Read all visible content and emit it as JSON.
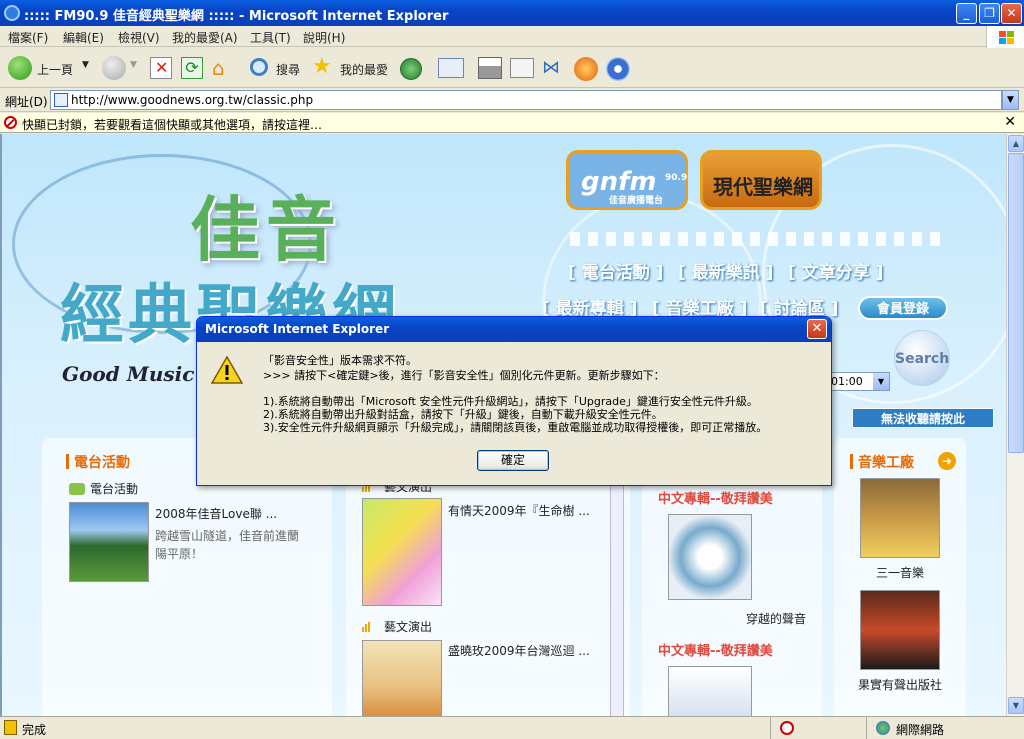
{
  "window": {
    "title": "::::: FM90.9 佳音經典聖樂網 ::::: - Microsoft Internet Explorer"
  },
  "menu": [
    "檔案(F)",
    "編輯(E)",
    "檢視(V)",
    "我的最愛(A)",
    "工具(T)",
    "說明(H)"
  ],
  "toolbar": {
    "back": "上一頁",
    "search": "搜尋",
    "favorites": "我的最愛"
  },
  "address": {
    "label": "網址(D)",
    "url": "http://www.goodnews.org.tw/classic.php"
  },
  "infobar": {
    "text": "快顯已封鎖，若要觀看這個快顯或其他選項，請按這裡…"
  },
  "page": {
    "title_line1": "佳音",
    "title_line2": "經典聖樂網",
    "tagline": "Good Music",
    "logo1": "gnfm",
    "logo1_sub": "佳音廣播電台",
    "logo1_num": "90.9",
    "logo2": "現代聖樂網",
    "nav_row1": [
      "[ 電台活動 ]",
      "[ 最新樂訊 ]",
      "[ 文章分享 ]"
    ],
    "nav_row2": [
      "[ 最新專輯 ]",
      "[ 音樂工廠 ]",
      "[ 討論區 ]"
    ],
    "member_button": "會員登錄",
    "search_button": "Search",
    "time_select": "01:00",
    "cant_view": "無法收聽請按此",
    "station": {
      "heading": "電台活動",
      "sub": "電台活動",
      "item_title": "2008年佳音Love聯 ...",
      "item_desc_1": "跨越雪山隧道，佳音前進蘭",
      "item_desc_2": "陽平原！"
    },
    "arts": {
      "sub1": "藝文演出",
      "item1": "有情天2009年『生命樹 ...",
      "sub2": "藝文演出",
      "item2": "盛曉玫2009年台灣巡迴 ..."
    },
    "albums": {
      "head1": "中文專輯--敬拜讚美",
      "item1": "穿越的聲音",
      "head2": "中文專輯--敬拜讚美"
    },
    "factory": {
      "heading": "音樂工廠",
      "item1": "三一音樂",
      "item2": "果實有聲出版社"
    }
  },
  "dialog": {
    "title": "Microsoft Internet Explorer",
    "line1": "「影音安全性」版本需求不符。",
    "line2": ">>> 請按下<確定鍵>後，進行「影音安全性」個別化元件更新。更新步驟如下：",
    "step1": "1).系統將自動帶出「Microsoft 安全性元件升級網站」，請按下「Upgrade」鍵進行安全性元件升級。",
    "step2": "2).系統將自動帶出升級對話盒，請按下「升級」鍵後，自動下載升級安全性元件。",
    "step3": "3).安全性元件升級網頁顯示「升級完成」，請關閉該頁後，重啟電腦並成功取得授權後，即可正常播放。",
    "ok": "確定"
  },
  "status": {
    "done": "完成",
    "zone": "網際網路"
  }
}
